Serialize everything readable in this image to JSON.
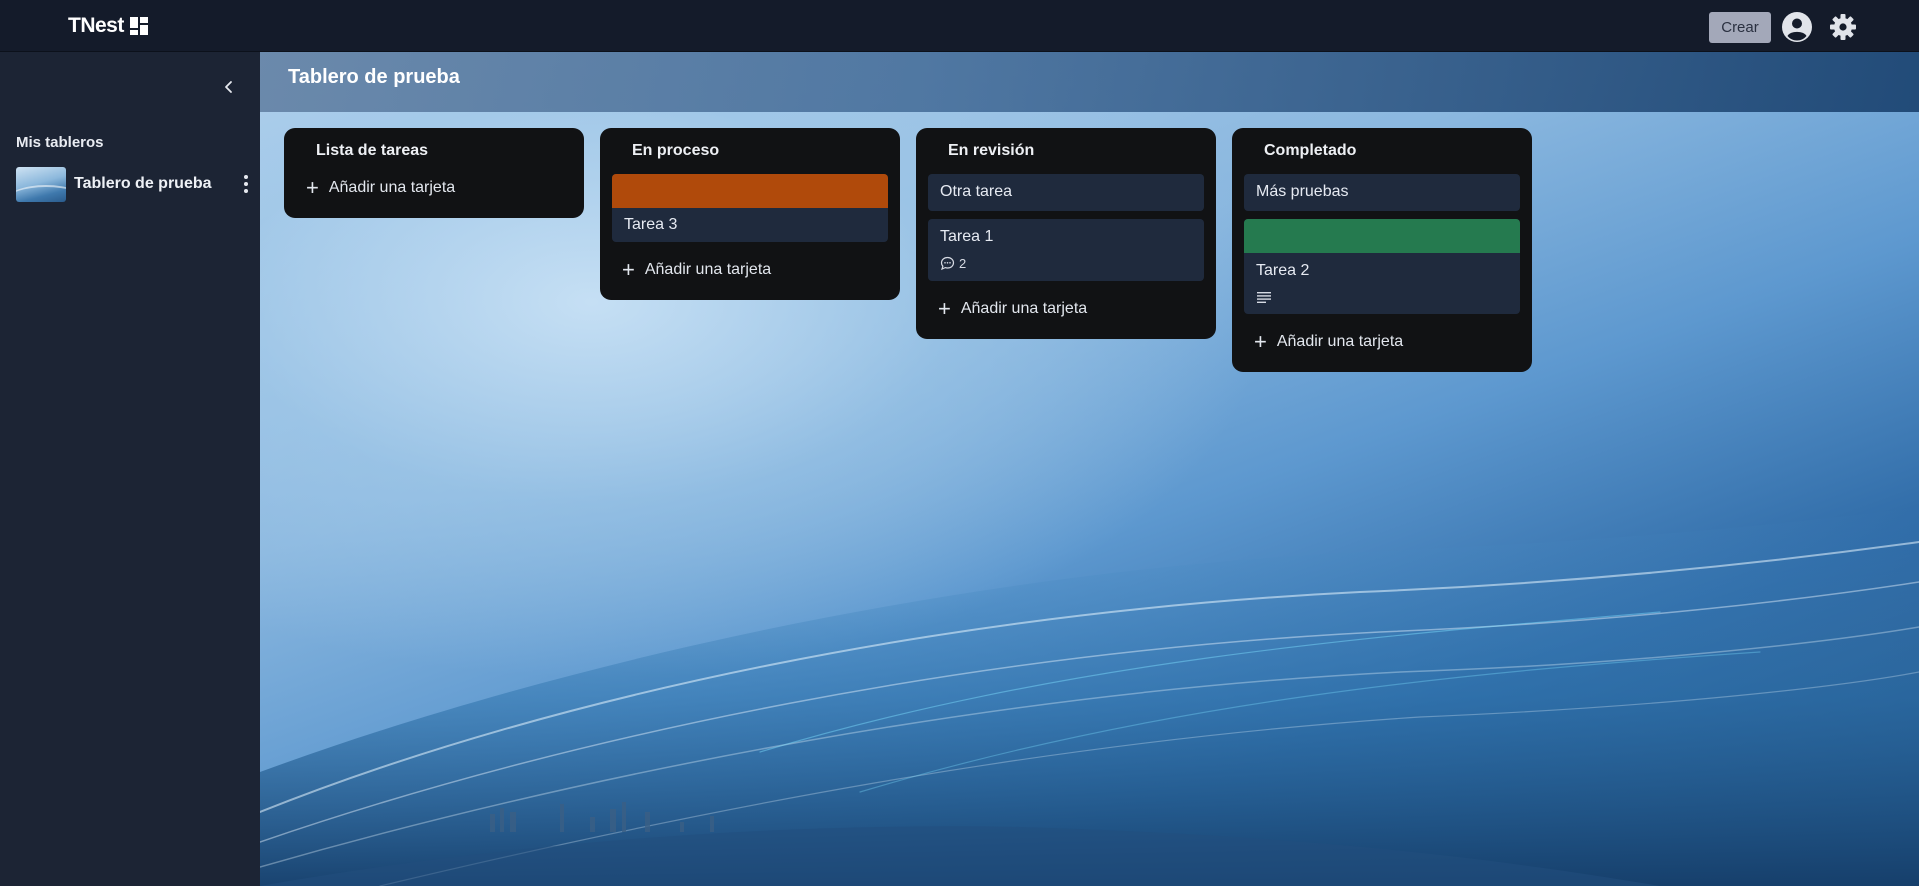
{
  "app": {
    "name": "TNest",
    "logo_icon": "board-grid-icon"
  },
  "topbar": {
    "create_label": "Crear",
    "avatar_icon": "user-circle-icon",
    "settings_icon": "gear-icon"
  },
  "sidebar": {
    "collapse_icon": "chevron-left-icon",
    "heading": "Mis tableros",
    "boards": [
      {
        "name": "Tablero de prueba",
        "menu_icon": "more-vertical-icon"
      }
    ]
  },
  "board": {
    "title": "Tablero de prueba",
    "add_card_label": "Añadir una tarjeta",
    "lists": [
      {
        "title": "Lista de tareas",
        "cards": []
      },
      {
        "title": "En proceso",
        "cards": [
          {
            "title": "Tarea 3",
            "cover_color": "#b04a0b"
          }
        ]
      },
      {
        "title": "En revisión",
        "cards": [
          {
            "title": "Otra tarea"
          },
          {
            "title": "Tarea 1",
            "comments": "2"
          }
        ]
      },
      {
        "title": "Completado",
        "cards": [
          {
            "title": "Más pruebas"
          },
          {
            "title": "Tarea 2",
            "cover_color": "#257a4f",
            "has_description": true
          }
        ]
      }
    ]
  },
  "colors": {
    "topbar": "#141b2a",
    "sidebar": "#1c2434",
    "list": "#111214",
    "card": "#1f2a3d"
  }
}
